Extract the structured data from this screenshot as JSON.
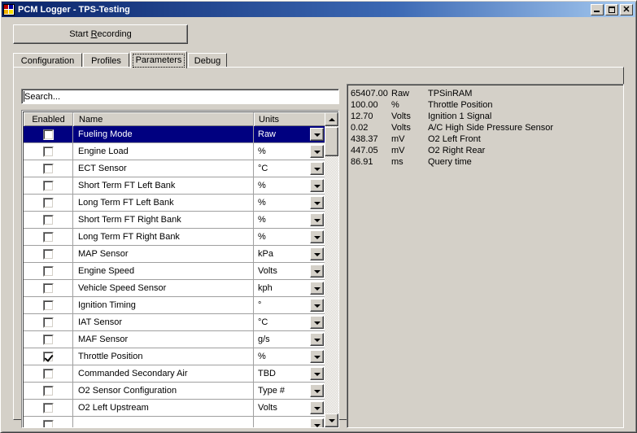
{
  "window": {
    "title": "PCM Logger - TPS-Testing",
    "icon": "app-icon",
    "minimize_label": "_",
    "maximize_label": "□",
    "close_label": "✕"
  },
  "toolbar": {
    "record_label_pre": "Start ",
    "record_accel": "R",
    "record_label_post": "ecording"
  },
  "tabs": [
    {
      "label": "Configuration",
      "active": false
    },
    {
      "label": "Profiles",
      "active": false
    },
    {
      "label": "Parameters",
      "active": true
    },
    {
      "label": "Debug",
      "active": false
    }
  ],
  "search": {
    "value": "Search...",
    "placeholder": "Search..."
  },
  "grid": {
    "columns": [
      "Enabled",
      "Name",
      "Units"
    ],
    "rows": [
      {
        "enabled": false,
        "name": "Fueling Mode",
        "units": "Raw",
        "selected": true
      },
      {
        "enabled": false,
        "name": "Engine Load",
        "units": "%",
        "selected": false
      },
      {
        "enabled": false,
        "name": "ECT Sensor",
        "units": "°C",
        "selected": false
      },
      {
        "enabled": false,
        "name": "Short Term FT Left Bank",
        "units": "%",
        "selected": false
      },
      {
        "enabled": false,
        "name": "Long Term FT Left Bank",
        "units": "%",
        "selected": false
      },
      {
        "enabled": false,
        "name": "Short Term FT Right Bank",
        "units": "%",
        "selected": false
      },
      {
        "enabled": false,
        "name": "Long Term FT Right Bank",
        "units": "%",
        "selected": false
      },
      {
        "enabled": false,
        "name": "MAP Sensor",
        "units": "kPa",
        "selected": false
      },
      {
        "enabled": false,
        "name": "Engine Speed",
        "units": "Volts",
        "selected": false
      },
      {
        "enabled": false,
        "name": "Vehicle Speed Sensor",
        "units": "kph",
        "selected": false
      },
      {
        "enabled": false,
        "name": "Ignition Timing",
        "units": "°",
        "selected": false
      },
      {
        "enabled": false,
        "name": "IAT Sensor",
        "units": "°C",
        "selected": false
      },
      {
        "enabled": false,
        "name": "MAF Sensor",
        "units": "g/s",
        "selected": false
      },
      {
        "enabled": true,
        "name": "Throttle Position",
        "units": "%",
        "selected": false
      },
      {
        "enabled": false,
        "name": "Commanded Secondary Air",
        "units": "TBD",
        "selected": false
      },
      {
        "enabled": false,
        "name": "O2 Sensor Configuration",
        "units": "Type #",
        "selected": false
      },
      {
        "enabled": false,
        "name": "O2 Left Upstream",
        "units": "Volts",
        "selected": false
      },
      {
        "enabled": false,
        "name": "",
        "units": "",
        "selected": false
      }
    ]
  },
  "readout": {
    "rows": [
      {
        "value": "65407.00",
        "units": "Raw",
        "name": "TPSinRAM"
      },
      {
        "value": "100.00",
        "units": "%",
        "name": "Throttle Position"
      },
      {
        "value": "12.70",
        "units": "Volts",
        "name": "Ignition 1 Signal"
      },
      {
        "value": "0.02",
        "units": "Volts",
        "name": "A/C High Side Pressure Sensor"
      },
      {
        "value": "438.37",
        "units": "mV",
        "name": "O2 Left Front"
      },
      {
        "value": "447.05",
        "units": "mV",
        "name": "O2 Right Rear"
      },
      {
        "value": "86.91",
        "units": "ms",
        "name": "Query time"
      }
    ]
  },
  "colors": {
    "face": "#d4d0c8",
    "title_start": "#0a246a",
    "title_end": "#a6caf0",
    "selection": "#000080",
    "field": "#ffffff"
  }
}
